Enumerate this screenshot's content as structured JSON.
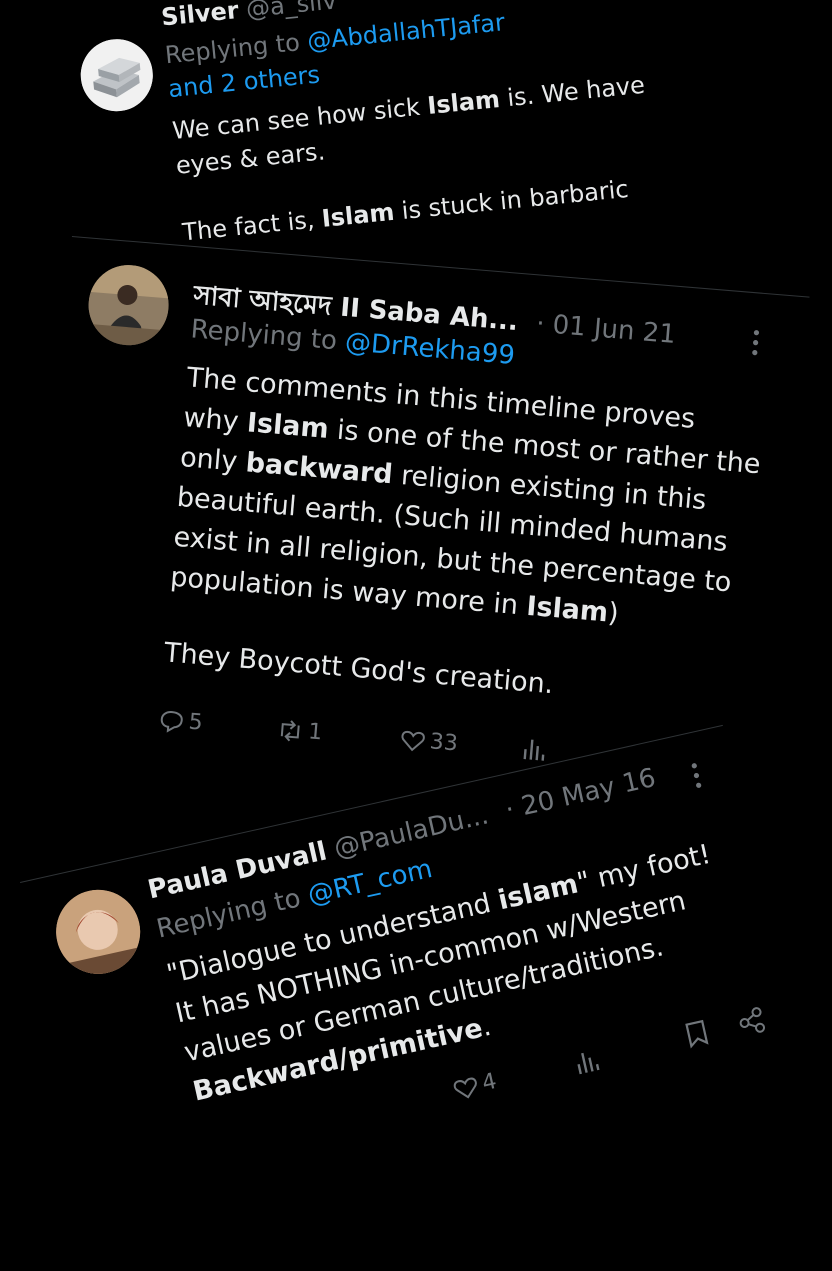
{
  "tweets": [
    {
      "display_name": "Silver",
      "handle": "@a_silv",
      "replying_label": "Replying to",
      "replying_handle": "@AbdallahTJafar",
      "replying_more": "and 2 others",
      "lines": [
        [
          {
            "t": "We can see how sick "
          },
          {
            "t": "Islam",
            "b": true
          },
          {
            "t": " is. We have"
          }
        ],
        [
          {
            "t": "eyes & ears."
          }
        ],
        [
          {
            "t": "The fact is, "
          },
          {
            "t": "Islam",
            "b": true
          },
          {
            "t": " is stuck in barbaric"
          }
        ]
      ]
    },
    {
      "display_name": "সাবা আহমেদ II Saba Ah...",
      "time": "· 01 Jun 21",
      "replying_label": "Replying to",
      "replying_handle": "@DrRekha99",
      "lines": [
        [
          {
            "t": "The comments in this timeline proves"
          }
        ],
        [
          {
            "t": "why "
          },
          {
            "t": "Islam",
            "b": true
          },
          {
            "t": " is one of the most or rather the"
          }
        ],
        [
          {
            "t": "only "
          },
          {
            "t": "backward",
            "b": true
          },
          {
            "t": " religion existing in this"
          }
        ],
        [
          {
            "t": "beautiful earth. (Such ill minded humans"
          }
        ],
        [
          {
            "t": "exist in all religion, but the percentage to"
          }
        ],
        [
          {
            "t": "population is way more in "
          },
          {
            "t": "Islam",
            "b": true
          },
          {
            "t": ")"
          }
        ],
        [
          {
            "t": ""
          }
        ],
        [
          {
            "t": "They Boycott God's creation."
          }
        ]
      ],
      "actions": {
        "replies": "5",
        "retweets": "1",
        "likes": "33"
      }
    },
    {
      "display_name": "Paula Duvall",
      "handle": "@PaulaDu...",
      "time": "· 20 May 16",
      "replying_label": "Replying to",
      "replying_handle": "@RT_com",
      "lines": [
        [
          {
            "t": "\"Dialogue to understand "
          },
          {
            "t": "islam",
            "b": true
          },
          {
            "t": "\" my foot!"
          }
        ],
        [
          {
            "t": "It has NOTHING in-common w/Western"
          }
        ],
        [
          {
            "t": "values or German culture/traditions."
          }
        ],
        [
          {
            "t": "Backward/primitive",
            "b": true
          },
          {
            "t": "."
          }
        ]
      ],
      "actions": {
        "likes": "4"
      }
    }
  ]
}
